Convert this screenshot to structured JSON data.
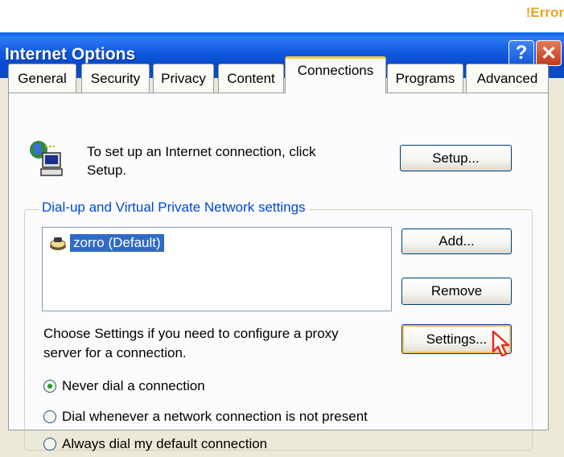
{
  "error_tag": "!Error",
  "window": {
    "title": "Internet Options",
    "help_glyph": "?",
    "close_glyph": "✕"
  },
  "tabs": [
    {
      "label": "General"
    },
    {
      "label": "Security"
    },
    {
      "label": "Privacy"
    },
    {
      "label": "Content"
    },
    {
      "label": "Connections",
      "active": true
    },
    {
      "label": "Programs"
    },
    {
      "label": "Advanced"
    }
  ],
  "setup": {
    "text_line1": "To set up an Internet connection, click",
    "text_line2": "Setup.",
    "button": "Setup..."
  },
  "dialup": {
    "group_label": "Dial-up and Virtual Private Network settings",
    "items": [
      "zorro (Default)"
    ],
    "add_button": "Add...",
    "remove_button": "Remove"
  },
  "proxy": {
    "text_line1": "Choose Settings if you need to configure a proxy",
    "text_line2": "server for a connection.",
    "button": "Settings..."
  },
  "radios": [
    {
      "label": "Never dial a connection",
      "checked": true
    },
    {
      "label": "Dial whenever a network connection is not present",
      "checked": false
    },
    {
      "label": "Always dial my default connection",
      "checked": false
    }
  ],
  "icons": {
    "network": "network-computer-icon",
    "connection": "dialup-connection-icon",
    "cursor": "mouse-cursor-icon"
  }
}
